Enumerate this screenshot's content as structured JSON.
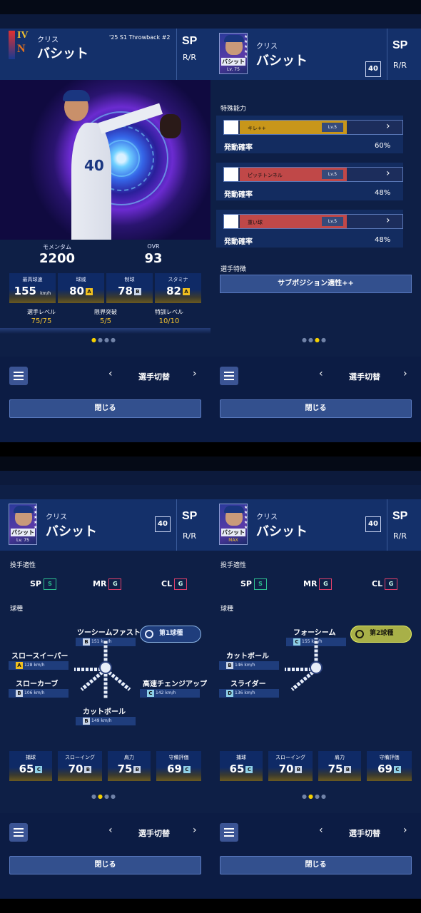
{
  "player": {
    "first_name": "クリス",
    "last_name": "バシット",
    "position": "SP",
    "hand": "R/R",
    "number": "40",
    "grade_numeral": "IV",
    "card_label": "'25 S1 Throwback #2",
    "card_plate": "バシット",
    "card_level_1": "Lv. 75",
    "card_level_2": "MAX"
  },
  "overview": {
    "momentum_label": "モメンタム",
    "momentum_value": "2200",
    "ovr_label": "OVR",
    "ovr_value": "93",
    "stats": [
      {
        "label": "最高球速",
        "value": "155",
        "unit": "km/h",
        "rank": ""
      },
      {
        "label": "球威",
        "value": "80",
        "rank": "A"
      },
      {
        "label": "制球",
        "value": "78",
        "rank": "B"
      },
      {
        "label": "スタミナ",
        "value": "82",
        "rank": "A"
      }
    ],
    "progress": [
      {
        "label": "選手レベル",
        "value": "75/75"
      },
      {
        "label": "限界突破",
        "value": "5/5"
      },
      {
        "label": "特訓レベル",
        "value": "10/10"
      }
    ]
  },
  "abilities": {
    "section_label": "特殊能力",
    "rate_label": "発動確率",
    "items": [
      {
        "name": "キレ++",
        "level": "Lv.5",
        "rate": "60%",
        "icon": "pitcher-icon",
        "color": "#c8961a"
      },
      {
        "name": "ピッチトンネル",
        "level": "Lv.5",
        "rate": "48%",
        "icon": "kick-icon",
        "color": "#c04848"
      },
      {
        "name": "重い球",
        "level": "Lv.5",
        "rate": "48%",
        "icon": "batter-icon",
        "color": "#c04848"
      }
    ],
    "trait_section_label": "選手特徴",
    "trait_button": "サブポジション適性++"
  },
  "aptitude": {
    "section_label": "投手適性",
    "items": [
      {
        "pos": "SP",
        "rank": "S",
        "color": "#2ec090"
      },
      {
        "pos": "MR",
        "rank": "G",
        "color": "#e0406a"
      },
      {
        "pos": "CL",
        "rank": "G",
        "color": "#e0406a"
      }
    ]
  },
  "pitches": {
    "section_label": "球種",
    "primary_tag": "第1球種",
    "secondary_tag": "第2球種",
    "primary": [
      {
        "name": "ツーシームファスト",
        "rank": "B",
        "speed": "151 km/h"
      },
      {
        "name": "スロースイーパー",
        "rank": "A",
        "speed": "128 km/h"
      },
      {
        "name": "スローカーブ",
        "rank": "B",
        "speed": "106 km/h"
      },
      {
        "name": "高速チェンジアップ",
        "rank": "C",
        "speed": "142 km/h"
      },
      {
        "name": "カットボール",
        "rank": "B",
        "speed": "149 km/h"
      }
    ],
    "secondary": [
      {
        "name": "フォーシーム",
        "rank": "C",
        "speed": "155 km/h"
      },
      {
        "name": "カットボール",
        "rank": "B",
        "speed": "146 km/h"
      },
      {
        "name": "スライダー",
        "rank": "D",
        "speed": "136 km/h"
      }
    ]
  },
  "fielding": [
    {
      "label": "捕球",
      "value": "65",
      "rank": "C"
    },
    {
      "label": "スローイング",
      "value": "70",
      "rank": "B"
    },
    {
      "label": "肩力",
      "value": "75",
      "rank": "B"
    },
    {
      "label": "守備評価",
      "value": "69",
      "rank": "C"
    }
  ],
  "nav": {
    "switch_label": "選手切替",
    "close_label": "閉じる",
    "prev": "‹",
    "next": "›"
  },
  "colors": {
    "accent_yellow": "#f2c230",
    "bg": "#0e1f46"
  }
}
